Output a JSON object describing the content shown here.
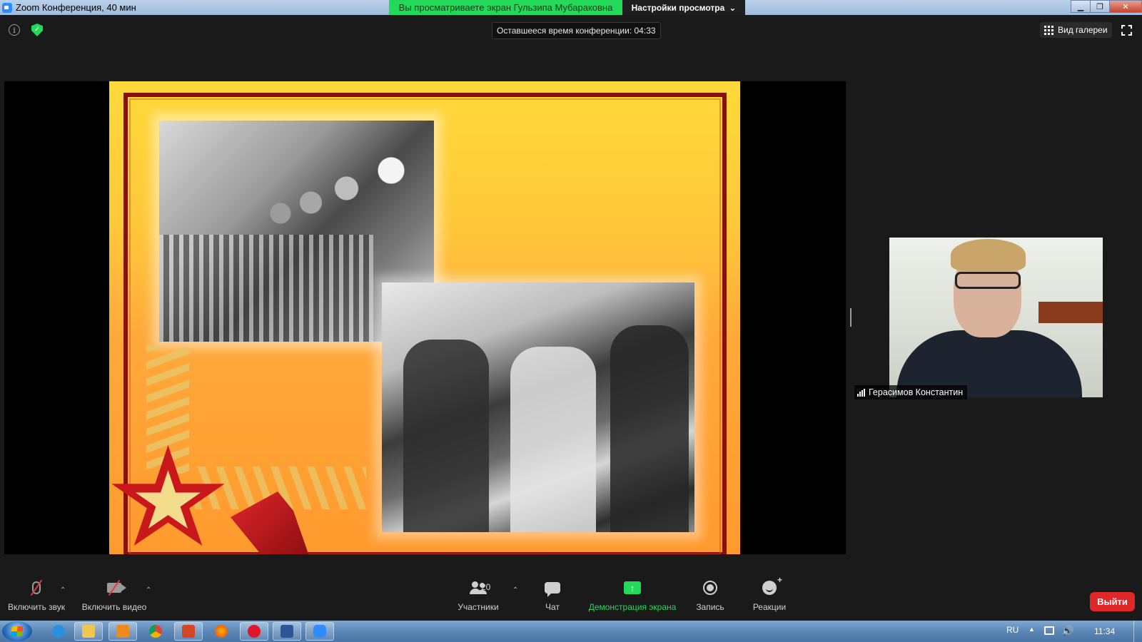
{
  "window": {
    "title": "Zoom Конференция, 40 мин",
    "share_banner": "Вы просматриваете экран Гульзипа Мубараковна",
    "view_options": "Настройки просмотра",
    "controls": [
      "minimize",
      "restore",
      "close"
    ]
  },
  "meeting": {
    "timer": "Оставшееся время конференции: 04:33",
    "gallery_view": "Вид галереи",
    "participant_name": "Герасимов Константин"
  },
  "toolbar": {
    "unmute_label": "Включить звук",
    "start_video_label": "Включить видео",
    "participants_label": "Участники",
    "participants_count": "20",
    "chat_label": "Чат",
    "share_screen_label": "Демонстрация экрана",
    "record_label": "Запись",
    "reactions_label": "Реакции",
    "leave_label": "Выйти"
  },
  "taskbar": {
    "language": "RU",
    "clock": "11:34",
    "apps": [
      "internet-explorer-icon",
      "file-explorer-icon",
      "media-player-icon",
      "chrome-icon",
      "powerpoint-icon",
      "firefox-icon",
      "opera-icon",
      "word-icon",
      "zoom-icon"
    ]
  },
  "colors": {
    "share_green": "#23d959",
    "leave_red": "#e02828",
    "meeting_bg": "#1a1a1a"
  }
}
